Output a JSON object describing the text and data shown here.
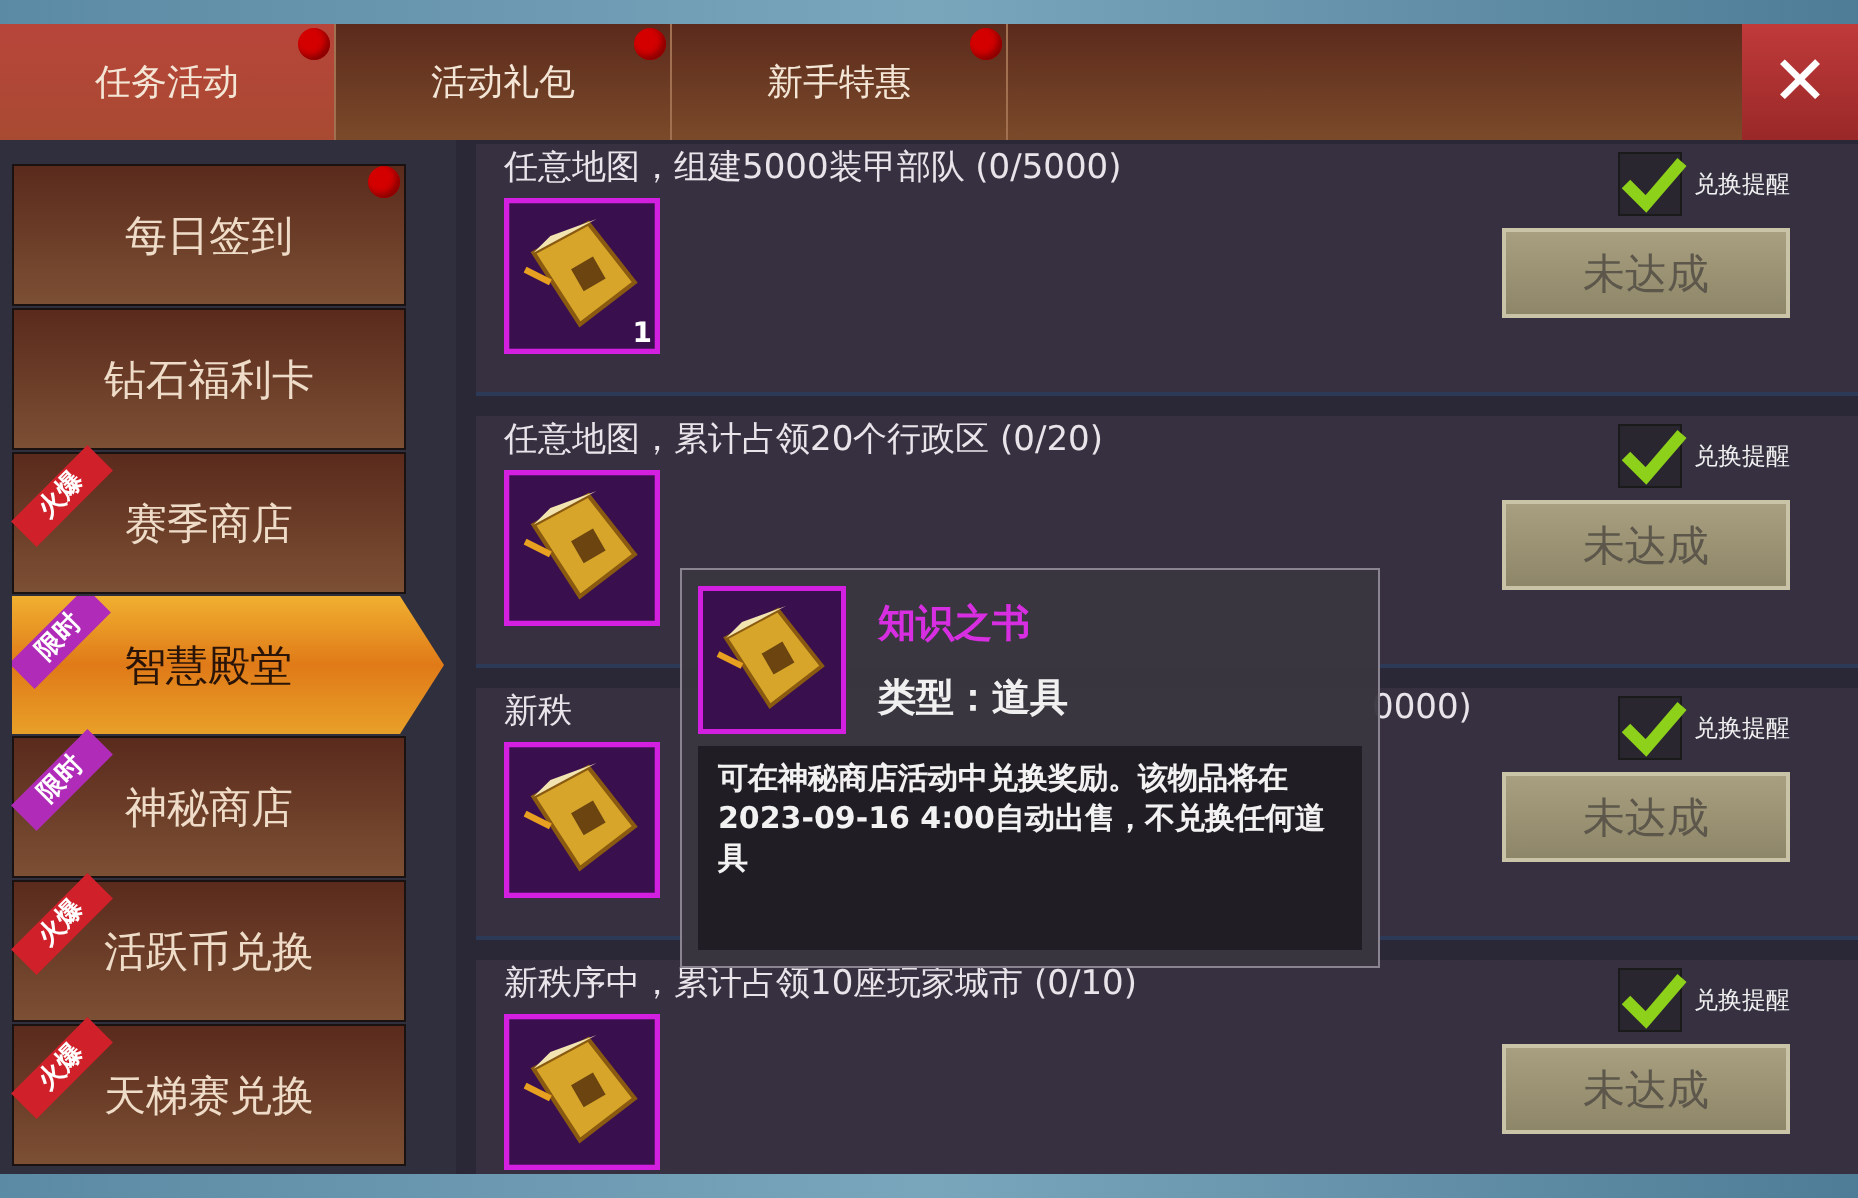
{
  "tabs": [
    {
      "label": "任务活动",
      "selected": true,
      "dot": true
    },
    {
      "label": "活动礼包",
      "selected": false,
      "dot": true
    },
    {
      "label": "新手特惠",
      "selected": false,
      "dot": true
    }
  ],
  "close_button": {
    "label": "✕"
  },
  "sidebar": {
    "items": [
      {
        "label": "每日签到",
        "selected": false,
        "dot": true
      },
      {
        "label": "钻石福利卡",
        "selected": false,
        "dot": false
      },
      {
        "label": "赛季商店",
        "selected": false,
        "dot": false,
        "badge": {
          "text": "火爆",
          "color": "#d0202a"
        }
      },
      {
        "label": "智慧殿堂",
        "selected": true,
        "dot": false,
        "badge": {
          "text": "限时",
          "color": "#b02cb8"
        }
      },
      {
        "label": "神秘商店",
        "selected": false,
        "dot": false,
        "badge": {
          "text": "限时",
          "color": "#b02cb8"
        }
      },
      {
        "label": "活跃币兑换",
        "selected": false,
        "dot": false,
        "badge": {
          "text": "火爆",
          "color": "#d0202a"
        }
      },
      {
        "label": "天梯赛兑换",
        "selected": false,
        "dot": false,
        "badge": {
          "text": "火爆",
          "color": "#d0202a"
        }
      }
    ]
  },
  "tasks": [
    {
      "title_parts": [
        "任意地图，组建5000装甲部队 (0/5000)"
      ],
      "reward_count": "1",
      "reminder": {
        "label": "兑换提醒",
        "checked": true
      },
      "button": "未达成"
    },
    {
      "title_parts": [
        "任意地图，累计占领20个行政区 (0/20)"
      ],
      "reminder": {
        "label": "兑换提醒",
        "checked": true
      },
      "button": "未达成"
    },
    {
      "title_parts": [
        "新秩",
        "0000)"
      ],
      "reminder": {
        "label": "兑换提醒",
        "checked": true
      },
      "button": "未达成"
    },
    {
      "title_parts": [
        "新秩序中，累计占领10座玩家城市 (0/10)"
      ],
      "reminder": {
        "label": "兑换提醒",
        "checked": true
      },
      "button": "未达成"
    }
  ],
  "tooltip": {
    "name": "知识之书",
    "type_line": "类型：道具",
    "description": "可在神秘商店活动中兑换奖励。该物品将在2023-09-16 4:00自动出售，不兑换任何道具"
  }
}
